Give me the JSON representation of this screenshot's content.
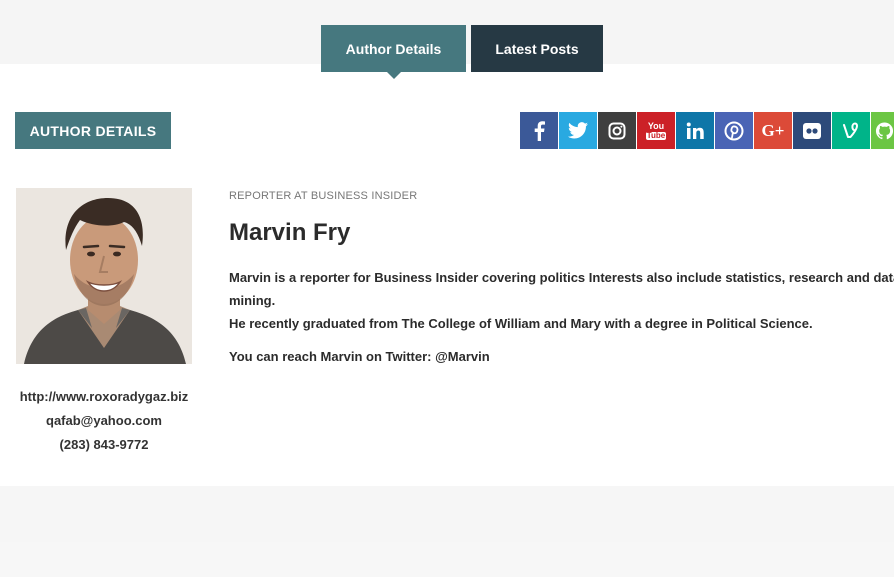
{
  "tabs": {
    "author_details": "Author Details",
    "latest_posts": "Latest Posts"
  },
  "section": {
    "label": "AUTHOR DETAILS"
  },
  "social": {
    "colors": {
      "facebook": "#3b5998",
      "twitter": "#29a9e1",
      "instagram": "#3f3f3f",
      "youtube": "#cc2127",
      "linkedin": "#0e76a8",
      "pinterest": "#b7081b",
      "googleplus": "#dc4a38",
      "flickr": "#2d2d4f",
      "vine": "#00b489",
      "github": "#6cc644"
    },
    "youtube_text": {
      "you": "You",
      "tube": "Tube"
    },
    "googleplus_text": "G+"
  },
  "author": {
    "role": "REPORTER AT BUSINESS INSIDER",
    "name": "Marvin Fry",
    "bio_line1": "Marvin is a reporter for Business Insider covering politics Interests also include statistics, research and data",
    "bio_line1_wrap": "mining.",
    "bio_line2": "He recently graduated from The College of William and Mary with a degree in Political Science.",
    "reach": "You can reach Marvin on Twitter: @Marvin",
    "website": "http://www.roxoradygaz.biz",
    "email": "qafab@yahoo.com",
    "phone": "(283) 843-9772"
  },
  "theme": {
    "primary": "#46787f",
    "dark": "#263944"
  }
}
